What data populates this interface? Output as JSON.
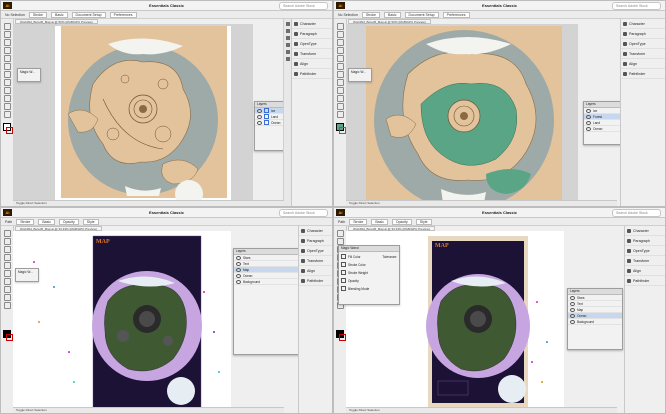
{
  "windows": [
    {
      "app_icon": "Ai",
      "workspace": "Essentials Classic",
      "search_placeholder": "Search Adobe Stock",
      "control_values": [
        "No Selection",
        "Stroke",
        "Basic",
        "Document Setup",
        "Preferences"
      ],
      "tab_label": "Worldbld_Bored5_Map.ai @ 50% (RGB/GPU Preview)",
      "dock_items": [
        "Character",
        "Paragraph",
        "OpenType",
        "Transform",
        "Align",
        "Pathfinder"
      ],
      "magic_wand_label": "Magic W...",
      "layers_title": "Layers",
      "layers": [
        "Ice",
        "Land",
        "Ocean"
      ],
      "status": "Toggle Direct Selection"
    },
    {
      "app_icon": "Ai",
      "workspace": "Essentials Classic",
      "search_placeholder": "Search Adobe Stock",
      "control_values": [
        "No Selection",
        "Stroke",
        "Basic",
        "Document Setup",
        "Preferences"
      ],
      "tab_label": "Worldbld_Bored5_Map.ai @ 50% (RGB/GPU Preview)",
      "dock_items": [
        "Character",
        "Paragraph",
        "OpenType",
        "Transform",
        "Align",
        "Pathfinder"
      ],
      "magic_wand_label": "Magic W...",
      "layers_title": "Layers",
      "layers": [
        "Ice",
        "Forest",
        "Land",
        "Ocean"
      ],
      "status": "Toggle Direct Selection"
    },
    {
      "app_icon": "Ai",
      "workspace": "Essentials Classic",
      "search_placeholder": "Search Adobe Stock",
      "control_values": [
        "Path",
        "Stroke",
        "Basic",
        "Opacity",
        "Style"
      ],
      "tab_label": "Worldbld_Bored5_Map.ai @ 33.33% (RGB/GPU Preview)",
      "dock_items": [
        "Character",
        "Paragraph",
        "OpenType",
        "Transform",
        "Align",
        "Pathfinder"
      ],
      "magic_wand_label": "Magic W...",
      "layers_title": "Layers",
      "layers": [
        "Stars",
        "Text",
        "Map",
        "Ocean",
        "Background"
      ],
      "status": "Toggle Direct Selection",
      "doc_title": "MAP"
    },
    {
      "app_icon": "Ai",
      "workspace": "Essentials Classic",
      "search_placeholder": "Search Adobe Stock",
      "control_values": [
        "Path",
        "Stroke",
        "Basic",
        "Opacity",
        "Style"
      ],
      "tab_label": "Worldbld_Bored5_Map.ai @ 33.33% (RGB/GPU Preview)",
      "dock_items": [
        "Character",
        "Paragraph",
        "OpenType",
        "Transform",
        "Align",
        "Pathfinder"
      ],
      "magic_wand_label": "Magic Wand",
      "layers_title": "Layers",
      "layers": [
        "Stars",
        "Text",
        "Map",
        "Ocean",
        "Background"
      ],
      "status": "Toggle Direct Selection",
      "doc_title": "MAP",
      "magic_options": [
        "Fill Color",
        "Stroke Color",
        "Stroke Weight",
        "Opacity",
        "Blending Mode"
      ],
      "magic_tolerance": "Tolerance:"
    }
  ],
  "colors": {
    "ocean_top": "#9eaaa7",
    "land": "#e2c39c",
    "forest": "#5aa585",
    "ice": "#f3f3f0",
    "poster_bg": "#1c1236",
    "ocean_bottom": "#c6a5e1",
    "moon": "#e7eef3",
    "land_dark": "#3f5a33"
  }
}
